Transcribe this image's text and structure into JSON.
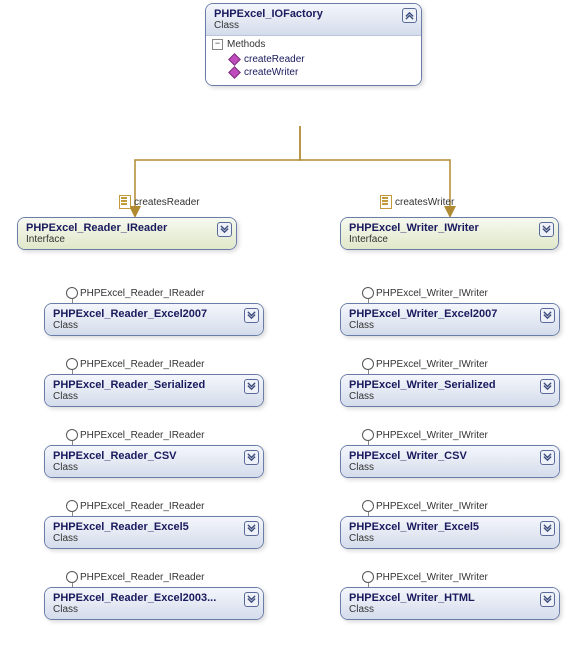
{
  "factory": {
    "title": "PHPExcel_IOFactory",
    "stereotype": "Class",
    "sectionLabel": "Methods",
    "methods": [
      "createReader",
      "createWriter"
    ]
  },
  "edges": {
    "left": "createsReader",
    "right": "createsWriter"
  },
  "interfaces": {
    "reader": {
      "title": "PHPExcel_Reader_IReader",
      "stereotype": "Interface"
    },
    "writer": {
      "title": "PHPExcel_Writer_IWriter",
      "stereotype": "Interface"
    }
  },
  "lolliReader": "PHPExcel_Reader_IReader",
  "lolliWriter": "PHPExcel_Writer_IWriter",
  "readers": [
    {
      "title": "PHPExcel_Reader_Excel2007",
      "stereotype": "Class"
    },
    {
      "title": "PHPExcel_Reader_Serialized",
      "stereotype": "Class"
    },
    {
      "title": "PHPExcel_Reader_CSV",
      "stereotype": "Class"
    },
    {
      "title": "PHPExcel_Reader_Excel5",
      "stereotype": "Class"
    },
    {
      "title": "PHPExcel_Reader_Excel2003...",
      "stereotype": "Class"
    }
  ],
  "writers": [
    {
      "title": "PHPExcel_Writer_Excel2007",
      "stereotype": "Class"
    },
    {
      "title": "PHPExcel_Writer_Serialized",
      "stereotype": "Class"
    },
    {
      "title": "PHPExcel_Writer_CSV",
      "stereotype": "Class"
    },
    {
      "title": "PHPExcel_Writer_Excel5",
      "stereotype": "Class"
    },
    {
      "title": "PHPExcel_Writer_HTML",
      "stereotype": "Class"
    }
  ]
}
